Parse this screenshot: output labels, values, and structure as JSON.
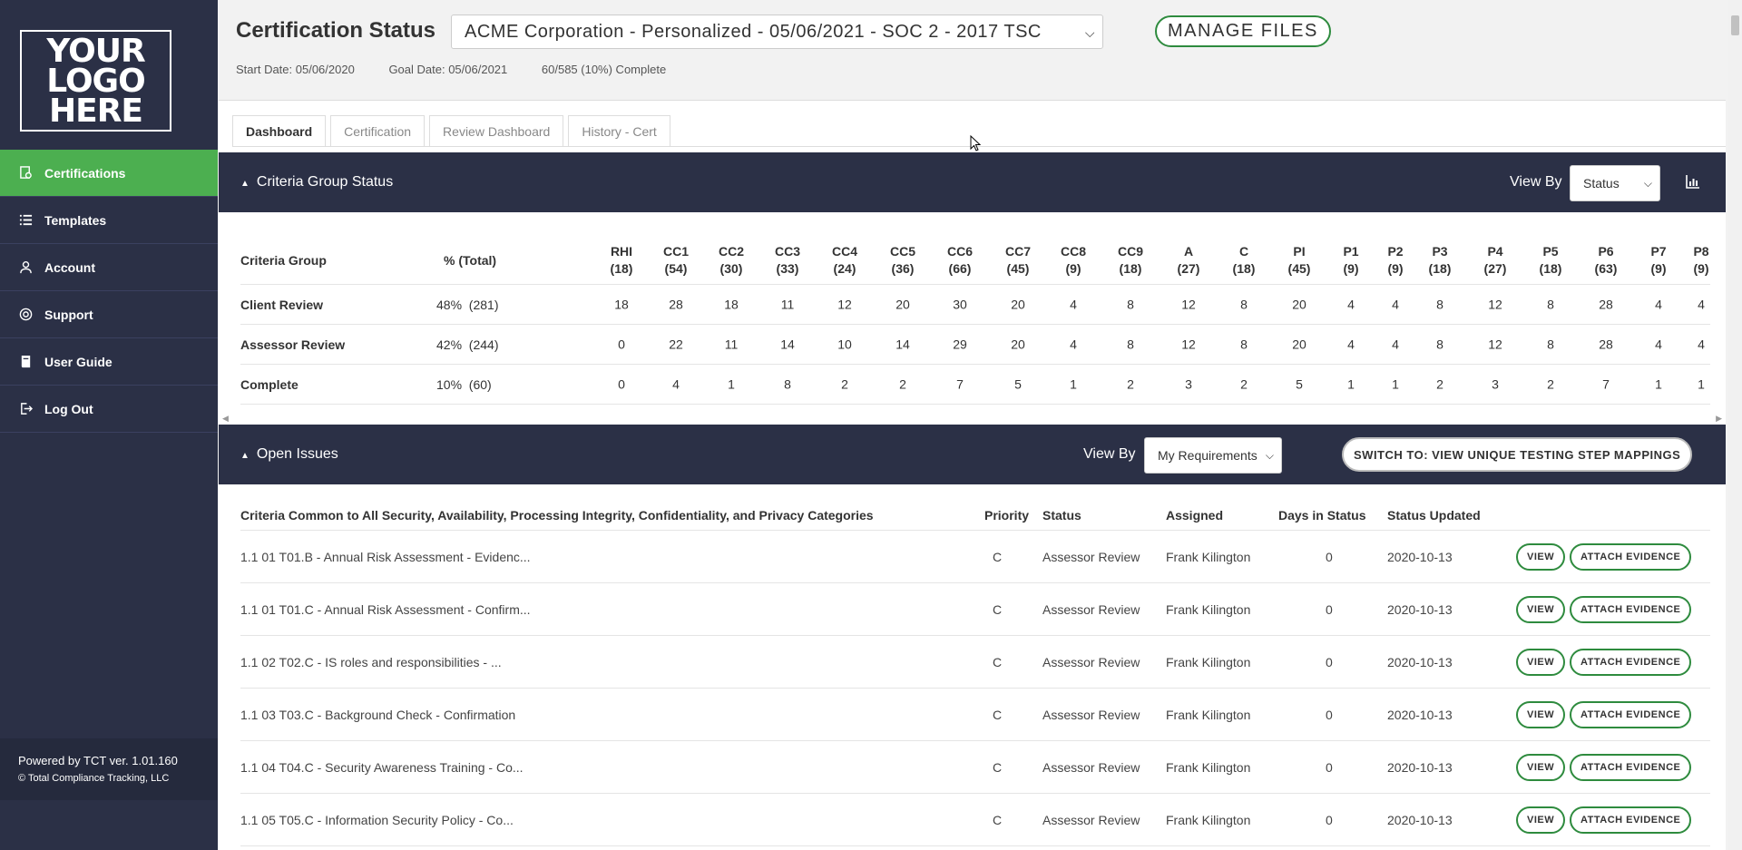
{
  "sidebar": {
    "logo_text": "YOUR LOGO HERE",
    "items": [
      {
        "label": "Certifications",
        "icon": "certificate-icon",
        "active": true
      },
      {
        "label": "Templates",
        "icon": "list-icon",
        "active": false
      },
      {
        "label": "Account",
        "icon": "user-icon",
        "active": false
      },
      {
        "label": "Support",
        "icon": "lifebuoy-icon",
        "active": false
      },
      {
        "label": "User Guide",
        "icon": "book-icon",
        "active": false
      },
      {
        "label": "Log Out",
        "icon": "logout-icon",
        "active": false
      }
    ],
    "footer_version": "Powered by TCT ver. 1.01.160",
    "footer_copyright": "© Total Compliance Tracking, LLC"
  },
  "header": {
    "title": "Certification Status",
    "selected_certification": "ACME Corporation - Personalized - 05/06/2021 - SOC 2 - 2017 TSC",
    "manage_files_label": "MANAGE FILES",
    "start_date": "Start Date: 05/06/2020",
    "goal_date": "Goal Date: 05/06/2021",
    "progress": "60/585 (10%) Complete"
  },
  "tabs": [
    "Dashboard",
    "Certification",
    "Review Dashboard",
    "History - Cert"
  ],
  "criteria_section": {
    "title": "Criteria Group Status",
    "view_by_label": "View By",
    "view_by_value": "Status",
    "group_header": "Criteria Group",
    "total_header": "% (Total)",
    "columns": [
      {
        "name": "RHI",
        "count": "(18)"
      },
      {
        "name": "CC1",
        "count": "(54)"
      },
      {
        "name": "CC2",
        "count": "(30)"
      },
      {
        "name": "CC3",
        "count": "(33)"
      },
      {
        "name": "CC4",
        "count": "(24)"
      },
      {
        "name": "CC5",
        "count": "(36)"
      },
      {
        "name": "CC6",
        "count": "(66)"
      },
      {
        "name": "CC7",
        "count": "(45)"
      },
      {
        "name": "CC8",
        "count": "(9)"
      },
      {
        "name": "CC9",
        "count": "(18)"
      },
      {
        "name": "A",
        "count": "(27)"
      },
      {
        "name": "C",
        "count": "(18)"
      },
      {
        "name": "PI",
        "count": "(45)"
      },
      {
        "name": "P1",
        "count": "(9)"
      },
      {
        "name": "P2",
        "count": "(9)"
      },
      {
        "name": "P3",
        "count": "(18)"
      },
      {
        "name": "P4",
        "count": "(27)"
      },
      {
        "name": "P5",
        "count": "(18)"
      },
      {
        "name": "P6",
        "count": "(63)"
      },
      {
        "name": "P7",
        "count": "(9)"
      },
      {
        "name": "P8",
        "count": "(9)"
      }
    ],
    "rows": [
      {
        "label": "Client Review",
        "total": "48%  (281)",
        "values": [
          "18",
          "28",
          "18",
          "11",
          "12",
          "20",
          "30",
          "20",
          "4",
          "8",
          "12",
          "8",
          "20",
          "4",
          "4",
          "8",
          "12",
          "8",
          "28",
          "4",
          "4"
        ]
      },
      {
        "label": "Assessor Review",
        "total": "42%  (244)",
        "values": [
          "0",
          "22",
          "11",
          "14",
          "10",
          "14",
          "29",
          "20",
          "4",
          "8",
          "12",
          "8",
          "20",
          "4",
          "4",
          "8",
          "12",
          "8",
          "28",
          "4",
          "4"
        ]
      },
      {
        "label": "Complete",
        "total": "10%  (60)",
        "values": [
          "0",
          "4",
          "1",
          "8",
          "2",
          "2",
          "7",
          "5",
          "1",
          "2",
          "3",
          "2",
          "5",
          "1",
          "1",
          "2",
          "3",
          "2",
          "7",
          "1",
          "1"
        ]
      }
    ]
  },
  "issues_section": {
    "title": "Open Issues",
    "view_by_label": "View By",
    "view_by_value": "My Requirements",
    "switch_label": "SWITCH TO: VIEW UNIQUE TESTING STEP MAPPINGS",
    "headers": {
      "criteria": "Criteria Common to All Security, Availability, Processing Integrity, Confidentiality, and Privacy Categories",
      "priority": "Priority",
      "status": "Status",
      "assigned": "Assigned",
      "days": "Days in Status",
      "updated": "Status Updated"
    },
    "view_label": "VIEW",
    "attach_label": "ATTACH EVIDENCE",
    "rows": [
      {
        "name": "1.1 01 T01.B - Annual Risk Assessment - Evidenc...",
        "priority": "C",
        "status": "Assessor Review",
        "assigned": "Frank Kilington",
        "days": "0",
        "updated": "2020-10-13"
      },
      {
        "name": "1.1 01 T01.C - Annual Risk Assessment - Confirm...",
        "priority": "C",
        "status": "Assessor Review",
        "assigned": "Frank Kilington",
        "days": "0",
        "updated": "2020-10-13"
      },
      {
        "name": "1.1 02 T02.C - IS roles and responsibilities - ...",
        "priority": "C",
        "status": "Assessor Review",
        "assigned": "Frank Kilington",
        "days": "0",
        "updated": "2020-10-13"
      },
      {
        "name": "1.1 03 T03.C - Background Check - Confirmation",
        "priority": "C",
        "status": "Assessor Review",
        "assigned": "Frank Kilington",
        "days": "0",
        "updated": "2020-10-13"
      },
      {
        "name": "1.1 04 T04.C - Security Awareness Training - Co...",
        "priority": "C",
        "status": "Assessor Review",
        "assigned": "Frank Kilington",
        "days": "0",
        "updated": "2020-10-13"
      },
      {
        "name": "1.1 05 T05.C - Information Security Policy - Co...",
        "priority": "C",
        "status": "Assessor Review",
        "assigned": "Frank Kilington",
        "days": "0",
        "updated": "2020-10-13"
      }
    ]
  },
  "colors": {
    "sidebar_bg": "#2b3046",
    "accent_green": "#4caf50",
    "button_border": "#2e8b3e"
  }
}
